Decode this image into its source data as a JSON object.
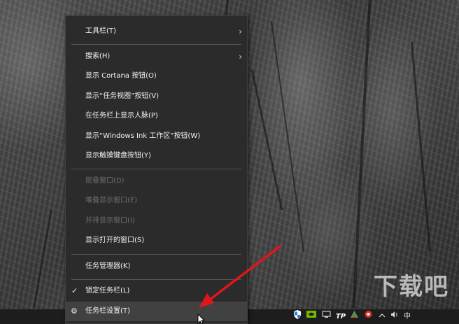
{
  "context_menu": {
    "items": [
      {
        "label": "工具栏(T)"
      },
      {
        "label": "搜索(H)"
      },
      {
        "label": "显示 Cortana 按钮(O)"
      },
      {
        "label": "显示“任务视图”按钮(V)"
      },
      {
        "label": "在任务栏上显示人脉(P)"
      },
      {
        "label": "显示“Windows Ink 工作区”按钮(W)"
      },
      {
        "label": "显示触摸键盘按钮(Y)"
      },
      {
        "label": "层叠窗口(D)"
      },
      {
        "label": "堆叠显示窗口(E)"
      },
      {
        "label": "并排显示窗口(I)"
      },
      {
        "label": "显示打开的窗口(S)"
      },
      {
        "label": "任务管理器(K)"
      },
      {
        "label": "锁定任务栏(L)"
      },
      {
        "label": "任务栏设置(T)"
      }
    ],
    "chevron_glyph": "›",
    "check_glyph": "✓",
    "gear_glyph": "⚙"
  },
  "taskbar": {
    "ime_label": "中"
  },
  "watermark": {
    "text": "下载吧"
  },
  "colors": {
    "menu_bg": "#2b2b2b",
    "menu_text": "#f2f2f2",
    "disabled_text": "#6d6d6d",
    "hover_bg": "#414141",
    "arrow_red": "#e0161b",
    "taskbar_bg": "#1d1d1d"
  },
  "icons": [
    "shield-icon",
    "nvidia-icon",
    "network-icon",
    "tp-icon",
    "app-icon",
    "antivirus-icon",
    "chevron-up-icon",
    "volume-icon"
  ]
}
